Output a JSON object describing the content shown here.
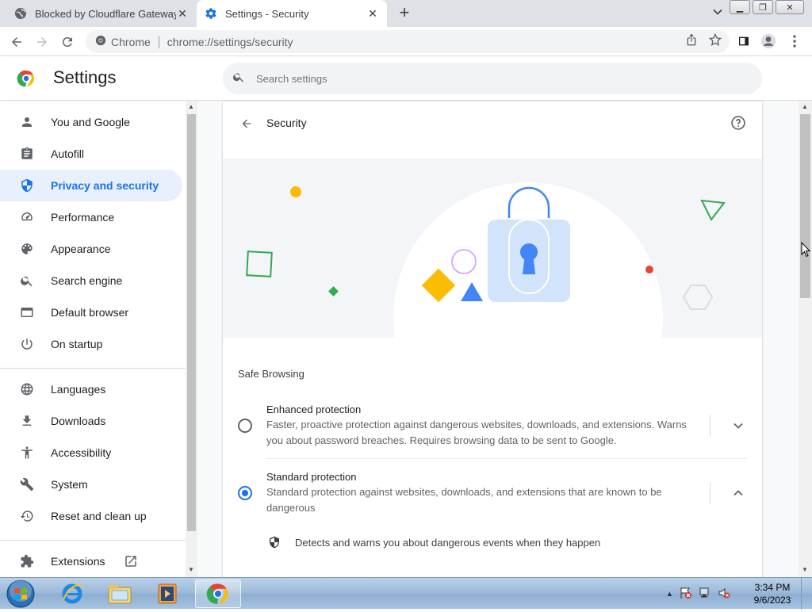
{
  "tabs": [
    {
      "title": "Blocked by Cloudflare Gateway",
      "icon": "globe-icon",
      "active": false
    },
    {
      "title": "Settings - Security",
      "icon": "gear-icon",
      "active": true
    }
  ],
  "toolbar": {
    "site_chip": "Chrome",
    "url": "chrome://settings/security"
  },
  "header": {
    "title": "Settings",
    "search_placeholder": "Search settings"
  },
  "sidebar": {
    "items": [
      {
        "label": "You and Google",
        "icon": "person-icon"
      },
      {
        "label": "Autofill",
        "icon": "clipboard-icon"
      },
      {
        "label": "Privacy and security",
        "icon": "shield-icon",
        "active": true
      },
      {
        "label": "Performance",
        "icon": "speedometer-icon"
      },
      {
        "label": "Appearance",
        "icon": "palette-icon"
      },
      {
        "label": "Search engine",
        "icon": "search-icon"
      },
      {
        "label": "Default browser",
        "icon": "browser-window-icon"
      },
      {
        "label": "On startup",
        "icon": "power-icon"
      },
      {
        "label": "Languages",
        "icon": "globe-icon"
      },
      {
        "label": "Downloads",
        "icon": "download-icon"
      },
      {
        "label": "Accessibility",
        "icon": "accessibility-icon"
      },
      {
        "label": "System",
        "icon": "wrench-icon"
      },
      {
        "label": "Reset and clean up",
        "icon": "history-icon"
      },
      {
        "label": "Extensions",
        "icon": "puzzle-icon"
      }
    ]
  },
  "main": {
    "title": "Security",
    "section_title": "Safe Browsing",
    "options": [
      {
        "title": "Enhanced protection",
        "description": "Faster, proactive protection against dangerous websites, downloads, and extensions. Warns you about password breaches. Requires browsing data to be sent to Google.",
        "selected": false,
        "expanded": false
      },
      {
        "title": "Standard protection",
        "description": "Standard protection against websites, downloads, and extensions that are known to be dangerous",
        "selected": true,
        "expanded": true
      }
    ],
    "sub_items": [
      {
        "text": "Detects and warns you about dangerous events when they happen",
        "icon": "shield-icon"
      }
    ]
  },
  "taskbar": {
    "time": "3:34 PM",
    "date": "9/6/2023"
  },
  "colors": {
    "accent": "#1a73e8",
    "active_bg": "#e8f0fe"
  }
}
